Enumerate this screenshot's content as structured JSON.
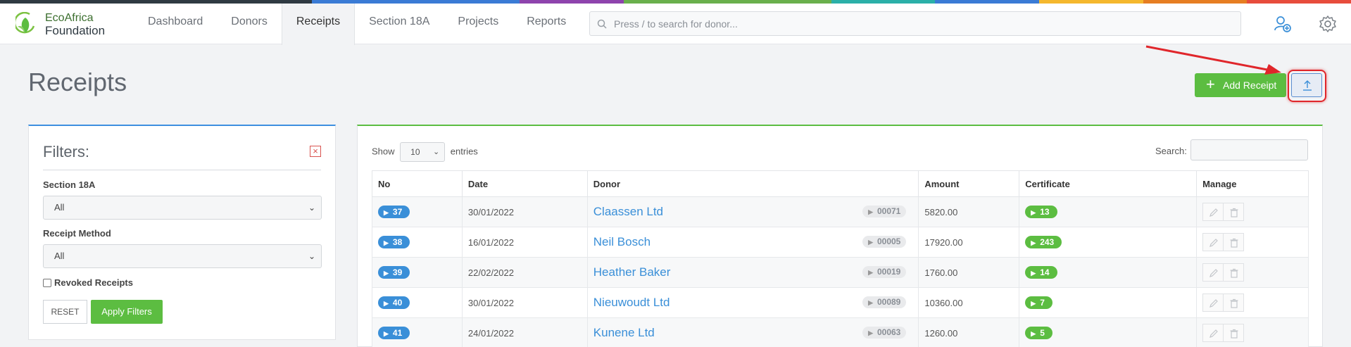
{
  "brand": {
    "line1": "EcoAfrica",
    "line2": "Foundation",
    "rainbow": [
      "#2f3a42",
      "#2f3a42",
      "#2f3a42",
      "#3a7bd5",
      "#3a7bd5",
      "#8e44ad",
      "#6ab04c",
      "#6ab04c",
      "#2bb0a8",
      "#3a7bd5",
      "#f5b82e",
      "#e67e22",
      "#e74c3c"
    ]
  },
  "nav": {
    "items": [
      {
        "label": "Dashboard"
      },
      {
        "label": "Donors"
      },
      {
        "label": "Receipts",
        "active": true
      },
      {
        "label": "Section 18A"
      },
      {
        "label": "Projects"
      },
      {
        "label": "Reports"
      }
    ],
    "search_placeholder": "Press / to search for donor..."
  },
  "page": {
    "title": "Receipts",
    "add_label": "Add Receipt"
  },
  "filters": {
    "title": "Filters:",
    "section18a_label": "Section 18A",
    "section18a_value": "All",
    "method_label": "Receipt Method",
    "method_value": "All",
    "revoked_label": "Revoked Receipts",
    "reset_label": "RESET",
    "apply_label": "Apply Filters"
  },
  "table": {
    "show_label": "Show",
    "entries_value": "10",
    "entries_label": "entries",
    "search_label": "Search:",
    "headers": [
      "No",
      "Date",
      "Donor",
      "Amount",
      "Certificate",
      "Manage"
    ],
    "rows": [
      {
        "no": "37",
        "date": "30/01/2022",
        "donor": "Claassen Ltd",
        "code": "00071",
        "amount": "5820.00",
        "cert": "13"
      },
      {
        "no": "38",
        "date": "16/01/2022",
        "donor": "Neil Bosch",
        "code": "00005",
        "amount": "17920.00",
        "cert": "243"
      },
      {
        "no": "39",
        "date": "22/02/2022",
        "donor": "Heather Baker",
        "code": "00019",
        "amount": "1760.00",
        "cert": "14"
      },
      {
        "no": "40",
        "date": "30/01/2022",
        "donor": "Nieuwoudt Ltd",
        "code": "00089",
        "amount": "10360.00",
        "cert": "7"
      },
      {
        "no": "41",
        "date": "24/01/2022",
        "donor": "Kunene Ltd",
        "code": "00063",
        "amount": "1260.00",
        "cert": "5"
      }
    ]
  },
  "colors": {
    "accent_green": "#5cbd41",
    "accent_blue": "#3a8fd8",
    "highlight_red": "#e0262b"
  },
  "icons": [
    "logo-leaf-icon",
    "search-icon",
    "add-user-icon",
    "gear-icon",
    "plus-icon",
    "upload-icon",
    "close-icon",
    "chevron-down-icon",
    "edit-icon",
    "trash-icon",
    "caret-right-icon"
  ]
}
